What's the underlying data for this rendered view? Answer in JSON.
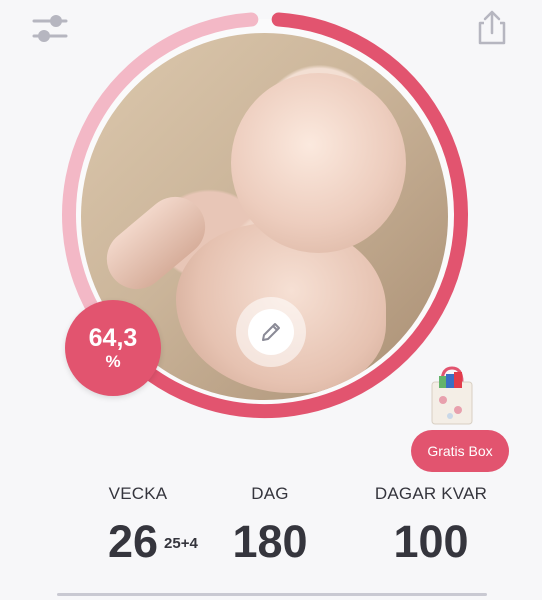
{
  "toolbar": {
    "settings_icon": "sliders-icon",
    "share_icon": "share-icon"
  },
  "progress": {
    "percent_value": 64.3,
    "percent_text": "64,3",
    "percent_symbol": "%",
    "colors": {
      "done": "#e2546f",
      "remaining": "#f3b8c6",
      "track": "#f3f3f5"
    }
  },
  "photo": {
    "edit_icon": "pencil-icon"
  },
  "promo": {
    "label": "Gratis Box",
    "icon": "gift-bag-icon"
  },
  "stats": {
    "week": {
      "label": "VECKA",
      "value": "26",
      "sup": "25+4"
    },
    "day": {
      "label": "DAG",
      "value": "180"
    },
    "remaining": {
      "label": "DAGAR KVAR",
      "value": "100"
    }
  }
}
